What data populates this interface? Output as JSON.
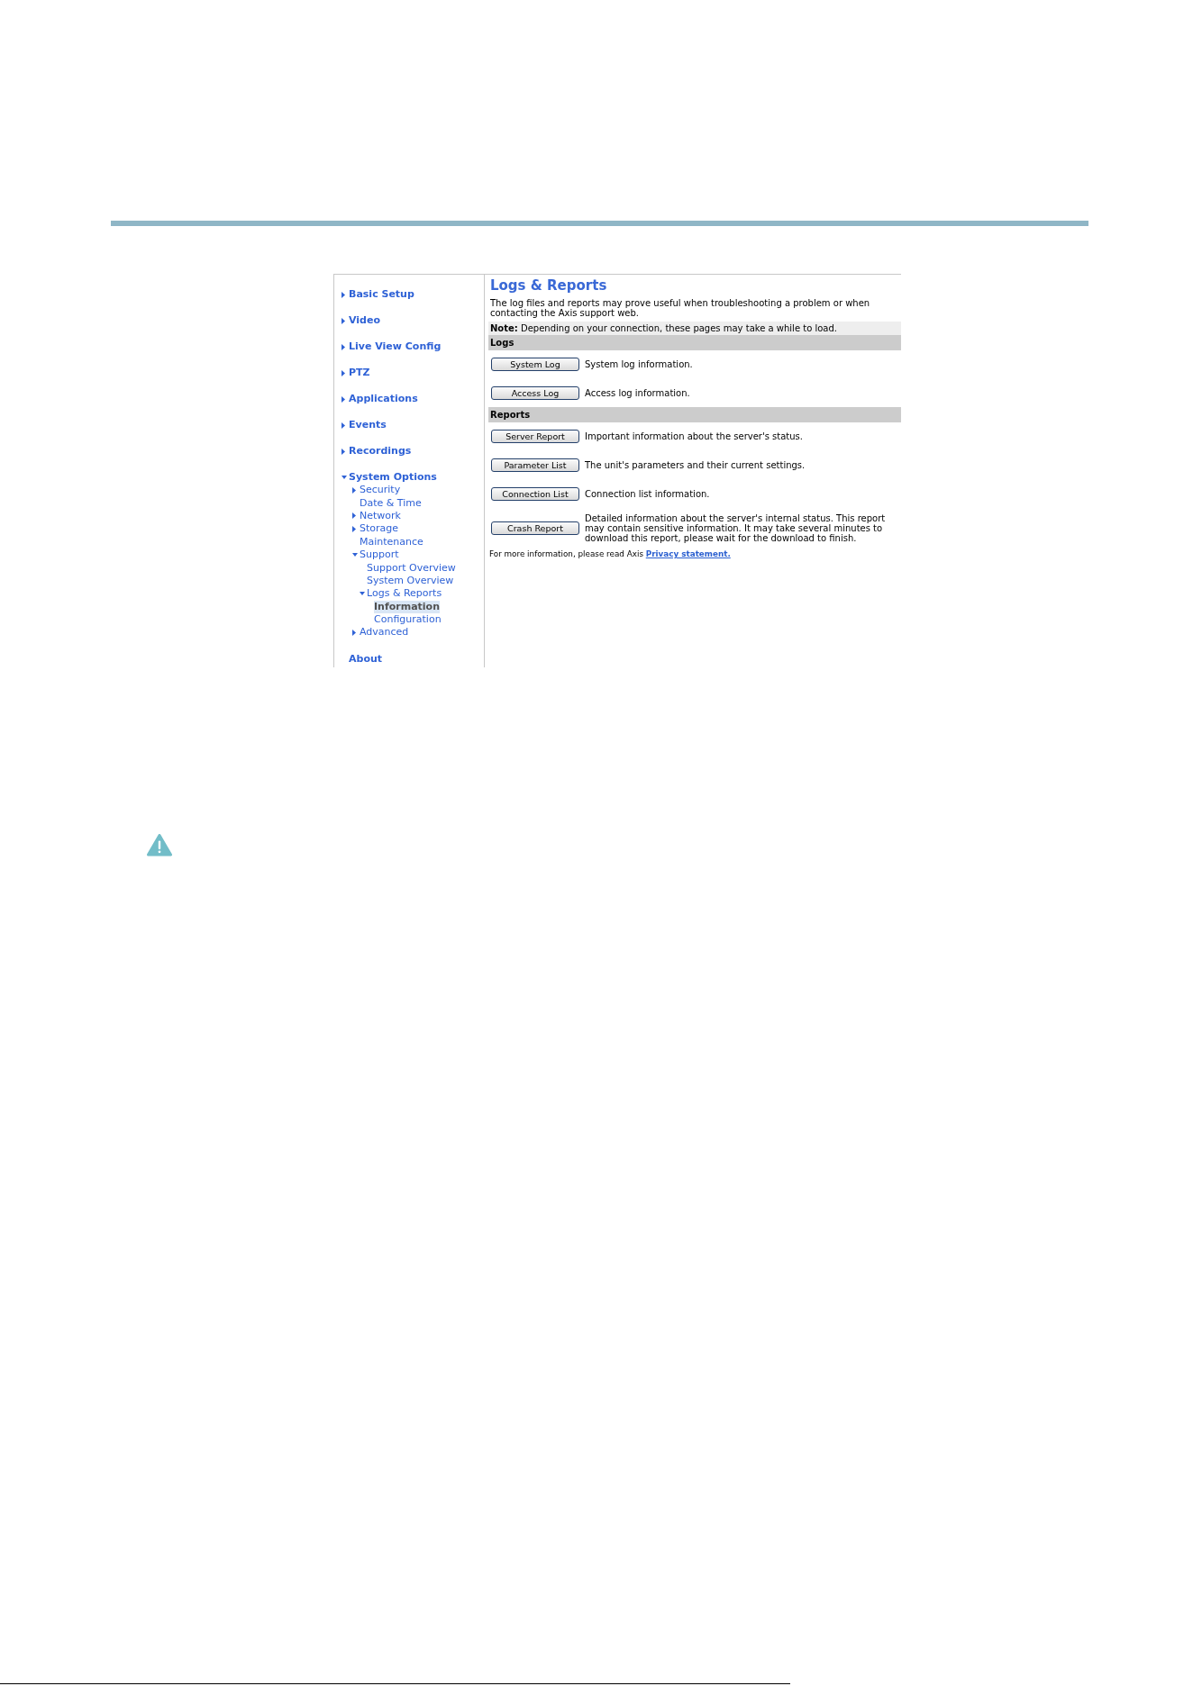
{
  "sidebar": {
    "items": [
      {
        "label": "Basic Setup",
        "kind": "section",
        "expanded": false,
        "selected": false
      },
      {
        "label": "Video",
        "kind": "section",
        "expanded": false,
        "selected": false
      },
      {
        "label": "Live View Config",
        "kind": "section",
        "expanded": false,
        "selected": false
      },
      {
        "label": "PTZ",
        "kind": "section",
        "expanded": false,
        "selected": false
      },
      {
        "label": "Applications",
        "kind": "section",
        "expanded": false,
        "selected": false
      },
      {
        "label": "Events",
        "kind": "section",
        "expanded": false,
        "selected": false
      },
      {
        "label": "Recordings",
        "kind": "section",
        "expanded": false,
        "selected": false
      },
      {
        "label": "System Options",
        "kind": "section",
        "expanded": true,
        "selected": false,
        "children": [
          {
            "label": "Security",
            "kind": "section",
            "expanded": false,
            "selected": false
          },
          {
            "label": "Date & Time",
            "kind": "page",
            "selected": false
          },
          {
            "label": "Network",
            "kind": "section",
            "expanded": false,
            "selected": false
          },
          {
            "label": "Storage",
            "kind": "section",
            "expanded": false,
            "selected": false
          },
          {
            "label": "Maintenance",
            "kind": "page",
            "selected": false
          },
          {
            "label": "Support",
            "kind": "section",
            "expanded": true,
            "selected": false,
            "children": [
              {
                "label": "Support Overview",
                "kind": "page",
                "selected": false
              },
              {
                "label": "System Overview",
                "kind": "page",
                "selected": false
              },
              {
                "label": "Logs & Reports",
                "kind": "section",
                "expanded": true,
                "selected": false,
                "children": [
                  {
                    "label": "Information",
                    "kind": "page",
                    "selected": true
                  },
                  {
                    "label": "Configuration",
                    "kind": "page",
                    "selected": false
                  }
                ]
              }
            ]
          },
          {
            "label": "Advanced",
            "kind": "section",
            "expanded": false,
            "selected": false
          }
        ]
      },
      {
        "label": "About",
        "kind": "page",
        "selected": false
      }
    ]
  },
  "content": {
    "title": "Logs & Reports",
    "intro": "The log files and reports may prove useful when troubleshooting a problem or when contacting the Axis support web.",
    "note": "**Note:** Depending on your connection, these pages may take a while to load.",
    "sections": [
      {
        "heading": "Logs",
        "entries": [
          {
            "button": "System Log",
            "description": "System log information."
          },
          {
            "button": "Access Log",
            "description": "Access log information."
          }
        ]
      },
      {
        "heading": "Reports",
        "entries": [
          {
            "button": "Server Report",
            "description": "Important information about the server's status."
          },
          {
            "button": "Parameter List",
            "description": "The unit's parameters and their current settings."
          },
          {
            "button": "Connection List",
            "description": "Connection list information."
          },
          {
            "button": "Crash Report",
            "description": "Detailed information about the server's internal status. This report may contain sensitive information. It may take several minutes to download this report, please wait for the download to finish."
          }
        ]
      }
    ],
    "footer": {
      "text": "For more information, please read Axis",
      "link": "Privacy statement."
    }
  }
}
